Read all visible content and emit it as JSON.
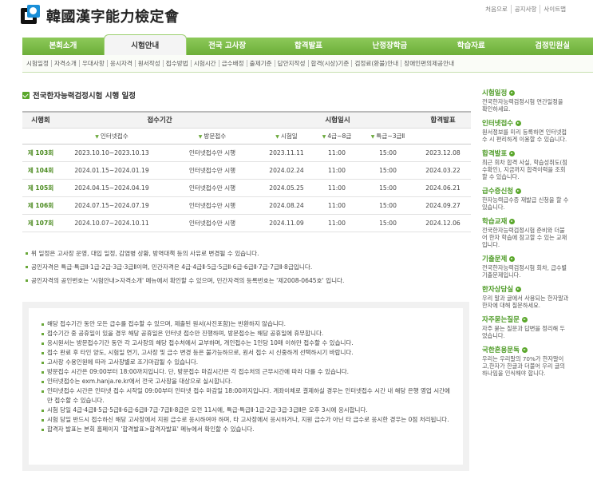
{
  "header": {
    "logo_text": "韓國漢字能力檢定會",
    "top_links": [
      "처음으로",
      "공지사항",
      "사이트맵"
    ]
  },
  "nav": {
    "items": [
      "본회소개",
      "시험안내",
      "전국 고사장",
      "합격발표",
      "난정장학금",
      "학습자료",
      "검정민원실"
    ],
    "active": "시험안내"
  },
  "subnav": {
    "items": [
      "시험일정",
      "자격소개",
      "우대사항",
      "응시자격",
      "원서작성",
      "접수방법",
      "시험시간",
      "급수배정",
      "출제기준",
      "답안지작성",
      "합격(시상)기준",
      "검정료(환불)안내",
      "장애인편의제공안내"
    ]
  },
  "main": {
    "title": "전국한자능력검정시험 시행 일정",
    "table": {
      "header_row1": [
        "시행회",
        "접수기간",
        "시험일시",
        "합격발표"
      ],
      "header_row2": [
        "인터넷접수",
        "방문접수",
        "시험일",
        "4급~8급",
        "특급~3급Ⅱ"
      ],
      "rows": [
        {
          "round": "제 103회",
          "internet": "2023.10.10~2023.10.13",
          "visit": "인터넷접수만 시행",
          "date": "2023.11.11",
          "t1": "11:00",
          "t2": "15:00",
          "result": "2023.12.08"
        },
        {
          "round": "제 104회",
          "internet": "2024.01.15~2024.01.19",
          "visit": "인터넷접수만 시행",
          "date": "2024.02.24",
          "t1": "11:00",
          "t2": "15:00",
          "result": "2024.03.22"
        },
        {
          "round": "제 105회",
          "internet": "2024.04.15~2024.04.19",
          "visit": "인터넷접수만 시행",
          "date": "2024.05.25",
          "t1": "11:00",
          "t2": "15:00",
          "result": "2024.06.21"
        },
        {
          "round": "제 106회",
          "internet": "2024.07.15~2024.07.19",
          "visit": "인터넷접수만 시행",
          "date": "2024.08.24",
          "t1": "11:00",
          "t2": "15:00",
          "result": "2024.09.27"
        },
        {
          "round": "제 107회",
          "internet": "2024.10.07~2024.10.11",
          "visit": "인터넷접수만 시행",
          "date": "2024.11.09",
          "t1": "11:00",
          "t2": "15:00",
          "result": "2024.12.06"
        }
      ]
    },
    "notes": [
      "위 일정은 고사장 운영, 대입 일정, 감염병 상황, 방역대책 등의 사유로 변경될 수 있습니다.",
      "공인자격은 특급·특급Ⅱ·1급·2급·3급·3급Ⅱ이며, 민간자격은 4급·4급Ⅱ·5급·5급Ⅱ·6급·6급Ⅱ·7급·7급Ⅱ·8급입니다.",
      "공인자격의 공인번호는 '시험안내>자격소개' 메뉴에서 확인할 수 있으며, 민간자격의 등록번호는 '제2008-0645호' 입니다."
    ],
    "info": [
      "해당 접수기간 동안 모든 급수를 접수할 수 있으며, 제출된 원서(사진포함)는 반환하지 않습니다.",
      "접수기간 중 공휴일이 있을 경우 해당 공휴일은 인터넷 접수만 진행하며, 방문접수는 해당 공휴일에 휴무합니다.",
      "응시원서는 방문접수기간 동안 각 고사장의 해당 접수처에서 교부하며, 개인접수는 1인당 10매 이하만 접수할 수 있습니다.",
      "접수 완료 후 타인 양도, 시험일 연기, 고사장 및 급수 변경 등은 불가능하므로, 원서 접수 시 신중하게 선택하시기 바랍니다.",
      "고사장 수용인원에 따라 고사장별로 조기마감될 수 있습니다.",
      "방문접수 시간은 09:00부터 18:00까지입니다. 단, 방문접수 마감시간은 각 접수처의 근무시간에 따라 다를 수 있습니다.",
      "인터넷접수는 exm.hanja.re.kr에서 전국 고사장을 대상으로 실시합니다.",
      "인터넷접수 시간은 인터넷 접수 시작일 09:00부터 인터넷 접수 마감일 18:00까지입니다. 계좌이체로 결제하실 경우는 인터넷접수 시간 내 해당 은행 영업 시간에만 접수할 수 있습니다.",
      "시험 당일 4급·4급Ⅱ·5급·5급Ⅱ·6급·6급Ⅱ·7급·7급Ⅱ·8급은 오전 11시에, 특급·특급Ⅱ·1급·2급·3급·3급Ⅱ은 오후 3시에 응시합니다.",
      "시험 당일 반드시 접수하신 해당 고사장에서 지원 급수로 응시하여야 하며, 타 고사장에서 응시하거나, 지원 급수가 아닌 타 급수로 응시한 경우는 0점 처리됩니다.",
      "합격자 발표는 본회 홈페이지 '합격발표>합격자발표' 메뉴에서 확인할 수 있습니다."
    ]
  },
  "sidebar": {
    "items": [
      {
        "title": "시험일정",
        "desc": "전국한자능력검정시험 연간일정을 확인하세요."
      },
      {
        "title": "인터넷접수",
        "desc": "원서정보를 미리 등록하면 인터넷접수 시 편리하게 이용할 수 있습니다."
      },
      {
        "title": "합격발표",
        "desc": "최근 회차 합격 사실, 학습성취도(점수확인), 지금까지 합격이력을 조회할 수 있습니다."
      },
      {
        "title": "급수증신청",
        "desc": "한자능력급수증 재발급 신청을 할 수 있습니다."
      },
      {
        "title": "학습교재",
        "desc": "전국한자능력검정시험 준비와 더불어 한자 학습에 참고할 수 있는 교재입니다."
      },
      {
        "title": "기출문제",
        "desc": "전국한자능력검정시험 회차, 급수별 기출문제입니다."
      },
      {
        "title": "한자상담실",
        "desc": "우리 말과 글에서 사용되는 한자말과 한자에 대해 질문하세요."
      },
      {
        "title": "자주묻는질문",
        "desc": "자주 묻는 질문과 답변을 정리해 두었습니다."
      },
      {
        "title": "국한혼용문독",
        "desc": "우리는 우리말의 70%가 한자말이고,한자가 한글과 더불어 우리 글의 하나임을 인식해야 합니다."
      }
    ]
  }
}
